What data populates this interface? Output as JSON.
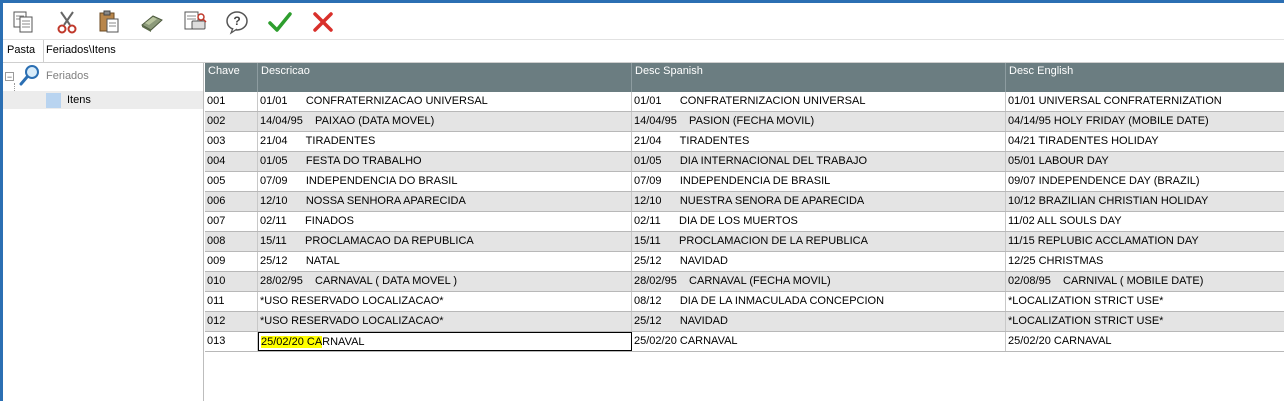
{
  "toolbar": {
    "buttons": [
      {
        "name": "copy-icon"
      },
      {
        "name": "cut-icon"
      },
      {
        "name": "paste-icon"
      },
      {
        "name": "eraser-icon"
      },
      {
        "name": "print-preview-icon"
      },
      {
        "name": "help-icon"
      },
      {
        "name": "confirm-icon",
        "color": "#2e9e2e"
      },
      {
        "name": "cancel-icon",
        "color": "#d9302b"
      }
    ]
  },
  "tabs": {
    "pasta": "Pasta",
    "path": "Feriados\\Itens"
  },
  "tree": {
    "root": "Feriados",
    "child": "Itens"
  },
  "grid": {
    "headers": [
      "Chave",
      "Descricao",
      "Desc Spanish",
      "Desc English"
    ],
    "header_color": "#6b7d81",
    "rows": [
      [
        "001",
        "01/01      CONFRATERNIZACAO UNIVERSAL",
        "01/01      CONFRATERNIZACION UNIVERSAL",
        "01/01 UNIVERSAL CONFRATERNIZATION"
      ],
      [
        "002",
        "14/04/95    PAIXAO (DATA MOVEL)",
        "14/04/95    PASION (FECHA MOVIL)",
        "04/14/95 HOLY FRIDAY (MOBILE DATE)"
      ],
      [
        "003",
        "21/04      TIRADENTES",
        "21/04      TIRADENTES",
        "04/21 TIRADENTES HOLIDAY"
      ],
      [
        "004",
        "01/05      FESTA DO TRABALHO",
        "01/05      DIA INTERNACIONAL DEL TRABAJO",
        "05/01 LABOUR DAY"
      ],
      [
        "005",
        "07/09      INDEPENDENCIA DO BRASIL",
        "07/09      INDEPENDENCIA DE BRASIL",
        "09/07 INDEPENDENCE DAY (BRAZIL)"
      ],
      [
        "006",
        "12/10      NOSSA SENHORA APARECIDA",
        "12/10      NUESTRA SENORA DE APARECIDA",
        "10/12 BRAZILIAN CHRISTIAN HOLIDAY"
      ],
      [
        "007",
        "02/11      FINADOS",
        "02/11      DIA DE LOS MUERTOS",
        "11/02 ALL SOULS DAY"
      ],
      [
        "008",
        "15/11      PROCLAMACAO DA REPUBLICA",
        "15/11      PROCLAMACION DE LA REPUBLICA",
        "11/15 REPLUBIC ACCLAMATION DAY"
      ],
      [
        "009",
        "25/12      NATAL",
        "25/12      NAVIDAD",
        "12/25 CHRISTMAS"
      ],
      [
        "010",
        "28/02/95    CARNAVAL ( DATA MOVEL )",
        "28/02/95    CARNAVAL (FECHA MOVIL)",
        "02/08/95    CARNIVAL ( MOBILE DATE)"
      ],
      [
        "011",
        "*USO RESERVADO LOCALIZACAO*",
        "08/12      DIA DE LA INMACULADA CONCEPCION",
        "*LOCALIZATION STRICT USE*"
      ],
      [
        "012",
        "*USO RESERVADO LOCALIZACAO*",
        "25/12      NAVIDAD",
        "*LOCALIZATION STRICT USE*"
      ],
      [
        "013",
        "25/02/20 CARNAVAL",
        "25/02/20 CARNAVAL",
        "25/02/20 CARNAVAL"
      ]
    ],
    "editing": {
      "row": "013",
      "selected_text": "25/02/20 CA",
      "rest_text": "RNAVAL",
      "highlight_color": "#ffff00"
    }
  }
}
